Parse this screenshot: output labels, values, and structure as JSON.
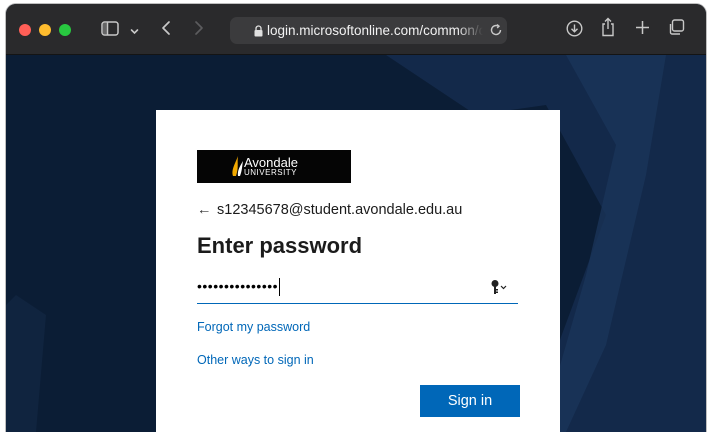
{
  "browser": {
    "url": "login.microsoftonline.com/common/o",
    "icons": [
      "sidebar-icon",
      "chevron-down-icon",
      "back-icon",
      "forward-icon",
      "lock-icon",
      "reload-icon",
      "download-icon",
      "share-icon",
      "new-tab-icon",
      "tabs-overview-icon"
    ],
    "traffic_colors": [
      "#ff5f57",
      "#febc2e",
      "#28c840"
    ]
  },
  "login": {
    "logo": {
      "line1": "Avondale",
      "line2": "UNIVERSITY"
    },
    "back_arrow": "←",
    "identity": "s12345678@student.avondale.edu.au",
    "title": "Enter password",
    "password_value": "•••••••••••••••",
    "forgot_link": "Forgot my password",
    "other_ways_link": "Other ways to sign in",
    "signin_label": "Sign in",
    "accent_color": "#0067b8"
  }
}
